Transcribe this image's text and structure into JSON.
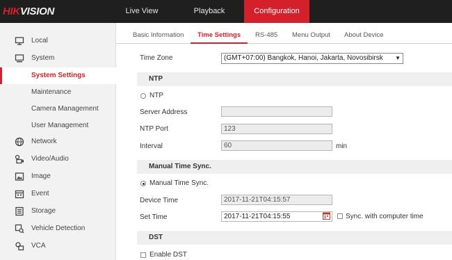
{
  "brand": {
    "part1": "HIK",
    "part2": "VISION"
  },
  "topnav": {
    "live_view": "Live View",
    "playback": "Playback",
    "configuration": "Configuration"
  },
  "sidebar": {
    "local": "Local",
    "system": "System",
    "system_settings": "System Settings",
    "maintenance": "Maintenance",
    "camera_management": "Camera Management",
    "user_management": "User Management",
    "network": "Network",
    "video_audio": "Video/Audio",
    "image": "Image",
    "event": "Event",
    "storage": "Storage",
    "vehicle_detection": "Vehicle Detection",
    "vca": "VCA"
  },
  "tabs": {
    "basic_information": "Basic Information",
    "time_settings": "Time Settings",
    "rs485": "RS-485",
    "menu_output": "Menu Output",
    "about_device": "About Device"
  },
  "form": {
    "time_zone_label": "Time Zone",
    "time_zone_value": "(GMT+07:00) Bangkok, Hanoi, Jakarta, Novosibirsk",
    "ntp_section": "NTP",
    "ntp_radio": "NTP",
    "server_address_label": "Server Address",
    "server_address_value": "",
    "ntp_port_label": "NTP Port",
    "ntp_port_value": "123",
    "interval_label": "Interval",
    "interval_value": "60",
    "interval_unit": "min",
    "manual_section": "Manual Time Sync.",
    "manual_radio": "Manual Time Sync.",
    "device_time_label": "Device Time",
    "device_time_value": "2017-11-21T04:15:57",
    "set_time_label": "Set Time",
    "set_time_value": "2017-11-21T04:15:55",
    "sync_label": "Sync. with computer time",
    "dst_section": "DST",
    "enable_dst": "Enable DST"
  },
  "colors": {
    "accent": "#d3202a",
    "topbar": "#1f1f1f",
    "sidebar": "#f2f2f2"
  }
}
